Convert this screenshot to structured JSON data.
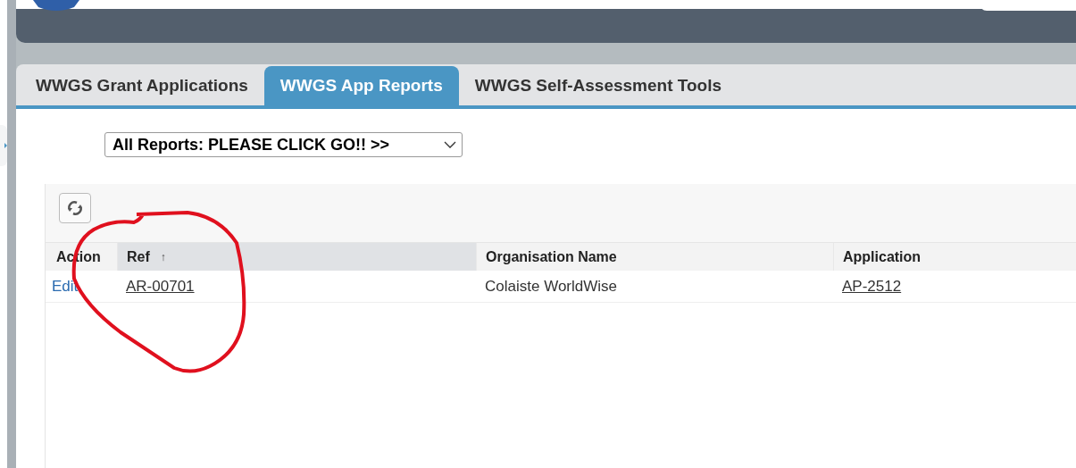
{
  "tabs": [
    {
      "label": "WWGS Grant Applications",
      "selected": false
    },
    {
      "label": "WWGS App Reports",
      "selected": true
    },
    {
      "label": "WWGS Self-Assessment Tools",
      "selected": false
    }
  ],
  "report_select": {
    "value": "All Reports: PLEASE CLICK GO!! >>"
  },
  "table": {
    "columns": [
      {
        "label": "Action",
        "sorted": false
      },
      {
        "label": "Ref",
        "sorted": true,
        "sort_arrow": "↑"
      },
      {
        "label": "Organisation Name",
        "sorted": false
      },
      {
        "label": "Application",
        "sorted": false
      }
    ],
    "rows": [
      {
        "action": "Edit",
        "ref": "AR-00701",
        "organisation": "Colaiste WorldWise",
        "application": "AP-2512"
      }
    ]
  }
}
